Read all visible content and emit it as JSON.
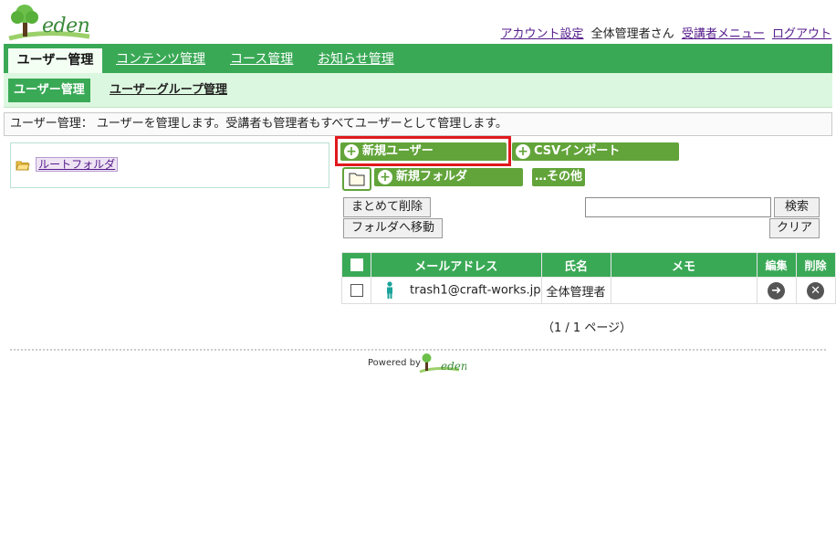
{
  "header": {
    "logo_text": "eden",
    "links": {
      "account": "アカウント設定",
      "user_name": "全体管理者さん",
      "learner_menu": "受講者メニュー",
      "logout": "ログアウト"
    }
  },
  "main_nav": {
    "tabs": [
      "ユーザー管理",
      "コンテンツ管理",
      "コース管理",
      "お知らせ管理"
    ],
    "active": "ユーザー管理"
  },
  "sub_nav": {
    "tabs": [
      "ユーザー管理",
      "ユーザーグループ管理"
    ]
  },
  "description": "ユーザー管理： ユーザーを管理します。受講者も管理者もすべてユーザーとして管理します。",
  "folder_tree": {
    "root": "ルートフォルダ"
  },
  "actions": {
    "new_user": "新規ユーザー",
    "csv_import": "CSVインポート",
    "new_folder": "新規フォルダ",
    "other": "…その他",
    "bulk_delete": "まとめて削除",
    "move_to_folder": "フォルダへ移動",
    "search": "検索",
    "clear": "クリア"
  },
  "search": {
    "value": "",
    "placeholder": ""
  },
  "table": {
    "columns": [
      "メールアドレス",
      "氏名",
      "メモ",
      "編集",
      "削除"
    ],
    "rows": [
      {
        "email": "trash1@craft-works.jp",
        "name": "全体管理者",
        "memo": ""
      }
    ]
  },
  "pager": "（1 / 1 ページ）",
  "footer": {
    "powered_by": "Powered by",
    "logo_text": "eden"
  },
  "colors": {
    "nav_green": "#3aa956",
    "button_green": "#62a43a",
    "sub_nav_bg": "#dcf7df",
    "highlight_red": "#e0191d"
  },
  "icons": {
    "folder_tree": "open-folder-icon",
    "new_folder_box": "folder-icon",
    "user_row": "person-icon",
    "edit": "arrow-right-circle-icon",
    "delete": "close-circle-icon"
  }
}
